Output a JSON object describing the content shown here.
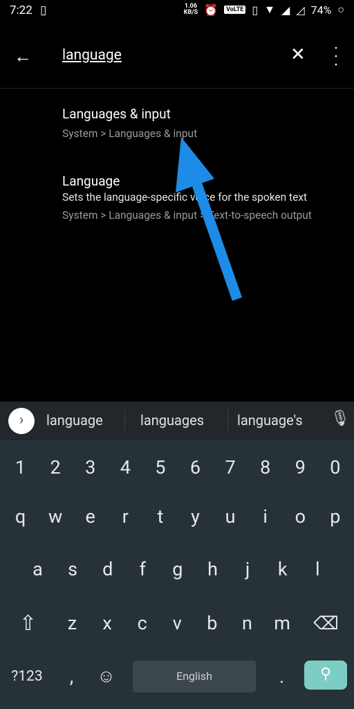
{
  "status_bar": {
    "time": "7:22",
    "net_speed": "1.06",
    "net_unit": "KB/S",
    "volte": "VoLTE",
    "battery": "74%"
  },
  "app_bar": {
    "query": "language"
  },
  "results": [
    {
      "title": "Languages & input",
      "path": "System > Languages & input"
    },
    {
      "title": "Language",
      "description": "Sets the language-specific voice for the spoken text",
      "path": "System > Languages & input > Text-to-speech output"
    }
  ],
  "annotation": {
    "arrow_color": "#1e8ce6"
  },
  "keyboard": {
    "suggestions": [
      "language",
      "languages",
      "language's"
    ],
    "rows": [
      [
        "1",
        "2",
        "3",
        "4",
        "5",
        "6",
        "7",
        "8",
        "9",
        "0"
      ],
      [
        "q",
        "w",
        "e",
        "r",
        "t",
        "y",
        "u",
        "i",
        "o",
        "p"
      ],
      [
        "a",
        "s",
        "d",
        "f",
        "g",
        "h",
        "j",
        "k",
        "l"
      ],
      [
        "z",
        "x",
        "c",
        "v",
        "b",
        "n",
        "m"
      ]
    ],
    "symbols_label": "?123",
    "comma": ",",
    "period": ".",
    "space_label": "English",
    "colors": {
      "background": "#263238",
      "action": "#7ecdc4"
    }
  }
}
